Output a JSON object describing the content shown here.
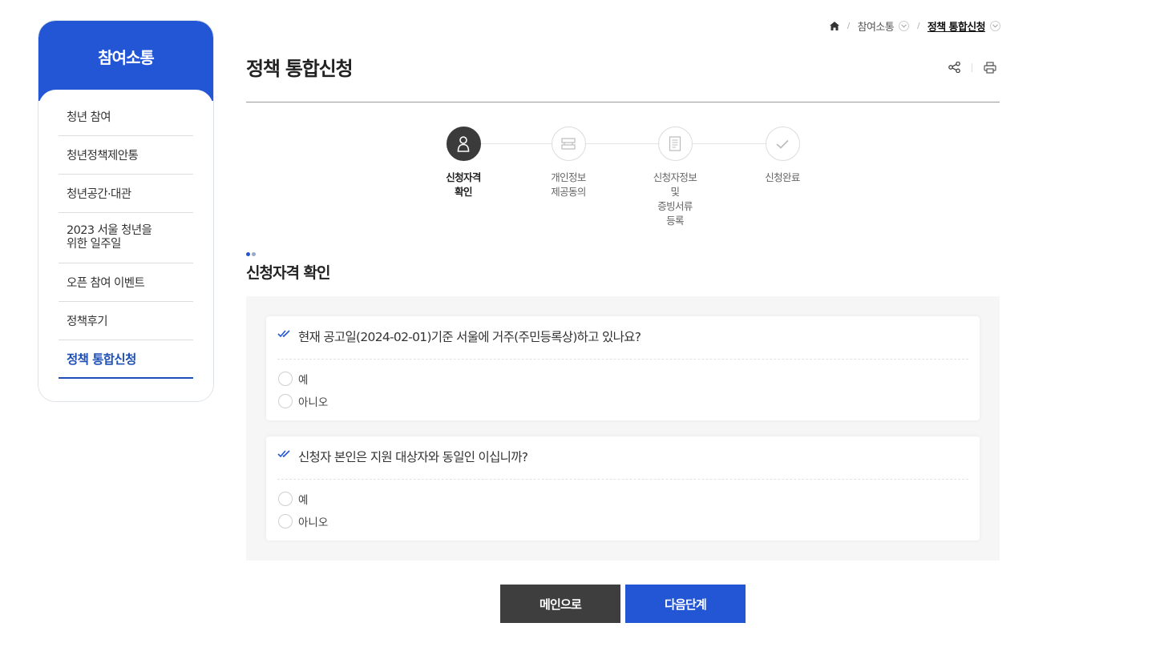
{
  "sidebar": {
    "title": "참여소통",
    "items": [
      {
        "label": "청년 참여"
      },
      {
        "label": "청년정책제안통"
      },
      {
        "label": "청년공간·대관"
      },
      {
        "label": "2023 서울 청년을\n위한 일주일"
      },
      {
        "label": "오픈 참여 이벤트"
      },
      {
        "label": "정책후기"
      },
      {
        "label": "정책 통합신청",
        "active": true
      }
    ]
  },
  "breadcrumb": {
    "items": [
      "참여소통",
      "정책 통합신청"
    ],
    "separator": "/"
  },
  "page": {
    "title": "정책 통합신청"
  },
  "steps": [
    {
      "label": "신청자격\n확인",
      "icon": "person-icon",
      "active": true
    },
    {
      "label": "개인정보\n제공동의",
      "icon": "document-stack-icon",
      "active": false
    },
    {
      "label": "신청자정보\n및\n증빙서류\n등록",
      "icon": "file-icon",
      "active": false
    },
    {
      "label": "신청완료",
      "icon": "check-icon",
      "active": false
    }
  ],
  "section": {
    "title": "신청자격 확인"
  },
  "questions": [
    {
      "text": "현재 공고일(2024-02-01)기준 서울에 거주(주민등록상)하고 있나요?",
      "options": [
        "예",
        "아니오"
      ]
    },
    {
      "text": "신청자 본인은 지원 대상자와 동일인 이십니까?",
      "options": [
        "예",
        "아니오"
      ]
    }
  ],
  "buttons": {
    "main": "메인으로",
    "next": "다음단계"
  },
  "colors": {
    "brand_blue": "#2356d4",
    "dark_button": "#3e3e3e",
    "active_nav": "#1f4fb5"
  }
}
